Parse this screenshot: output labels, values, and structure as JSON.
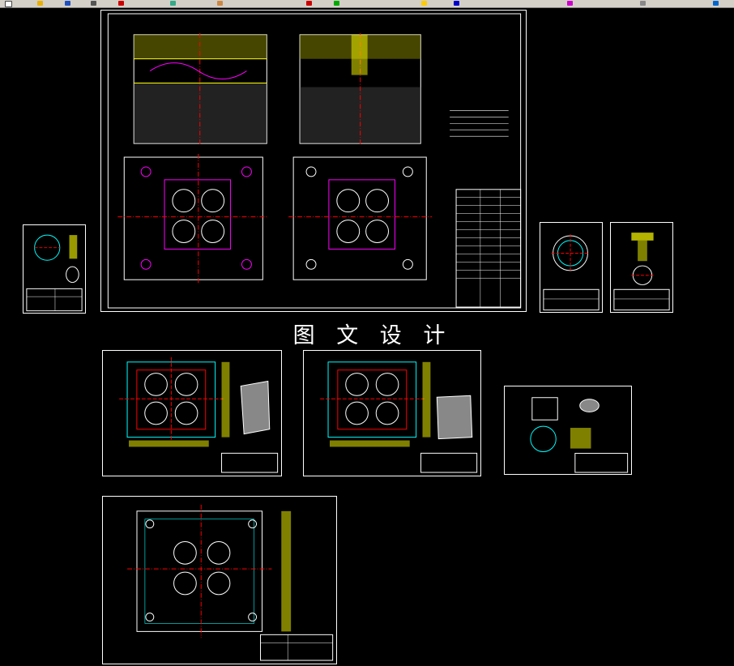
{
  "watermark": {
    "text": "图 文 设 计"
  },
  "colors": {
    "background": "#000000",
    "frame": "#ffffff",
    "outline": "#00ffff",
    "centerline": "#ff0000",
    "hatch": "#ffff00",
    "accent": "#0000ff",
    "green": "#00ff00",
    "magenta": "#ff00ff"
  },
  "toolbar": {
    "icons": [
      "new-icon",
      "open-icon",
      "save-icon",
      "print-icon",
      "cut-icon",
      "copy-icon",
      "paste-icon",
      "undo-icon",
      "redo-icon",
      "zoom-icon",
      "pan-icon",
      "layer-icon",
      "properties-icon",
      "help-icon"
    ]
  },
  "drawings": [
    "assembly-drawing",
    "part-drawing-left",
    "part-drawing-right-a",
    "part-drawing-right-b",
    "plate-drawing-a",
    "plate-drawing-b",
    "insert-drawing",
    "base-plate-drawing"
  ]
}
